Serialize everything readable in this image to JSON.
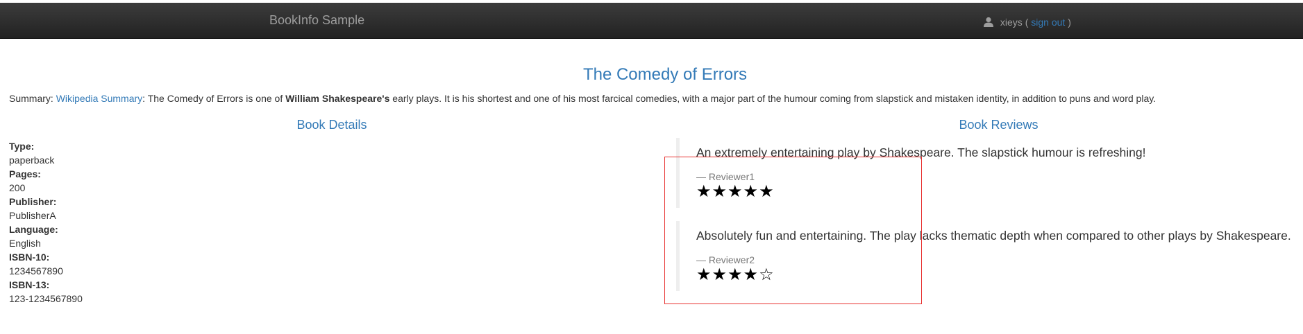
{
  "navbar": {
    "brand": "BookInfo Sample",
    "user": {
      "icon": "user-icon",
      "name": "xieys",
      "open_paren": "(",
      "sign_out": "sign out",
      "close_paren": ")"
    }
  },
  "book": {
    "title": "The Comedy of Errors",
    "summary": {
      "prefix": "Summary: ",
      "link": "Wikipedia Summary",
      "text1": ": The Comedy of Errors is one of ",
      "bold": "William Shakespeare's",
      "text2": " early plays. It is his shortest and one of his most farcical comedies, with a major part of the humour coming from slapstick and mistaken identity, in addition to puns and word play."
    }
  },
  "details": {
    "heading": "Book Details",
    "fields": [
      {
        "label": "Type:",
        "value": "paperback"
      },
      {
        "label": "Pages:",
        "value": "200"
      },
      {
        "label": "Publisher:",
        "value": "PublisherA"
      },
      {
        "label": "Language:",
        "value": "English"
      },
      {
        "label": "ISBN-10:",
        "value": "1234567890"
      },
      {
        "label": "ISBN-13:",
        "value": "123-1234567890"
      }
    ]
  },
  "reviews": {
    "heading": "Book Reviews",
    "items": [
      {
        "text": "An extremely entertaining play by Shakespeare. The slapstick humour is refreshing!",
        "reviewer": "— Reviewer1",
        "rating": 5,
        "stars": "★★★★★"
      },
      {
        "text": "Absolutely fun and entertaining. The play lacks thematic depth when compared to other plays by Shakespeare.",
        "reviewer": "— Reviewer2",
        "rating": 4,
        "stars": "★★★★☆"
      }
    ]
  },
  "colors": {
    "link": "#337ab7",
    "navbar": "#222222",
    "highlight": "#e8302f"
  }
}
